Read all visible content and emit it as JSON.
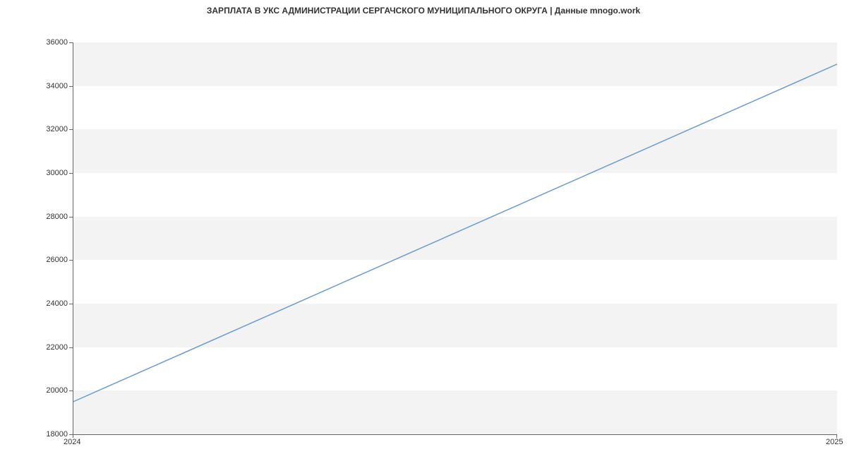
{
  "chart_data": {
    "type": "line",
    "title": "ЗАРПЛАТА В УКС АДМИНИСТРАЦИИ СЕРГАЧСКОГО МУНИЦИПАЛЬНОГО ОКРУГА | Данные mnogo.work",
    "x": [
      2024,
      2025
    ],
    "x_tick_labels": [
      "2024",
      "2025"
    ],
    "y_ticks": [
      18000,
      20000,
      22000,
      24000,
      26000,
      28000,
      30000,
      32000,
      34000,
      36000
    ],
    "series": [
      {
        "name": "salary",
        "values": [
          19500,
          35000
        ],
        "color": "#6b9bd1"
      }
    ],
    "xlabel": "",
    "ylabel": "",
    "ylim": [
      18000,
      36000
    ],
    "xlim": [
      2024,
      2025
    ],
    "grid_bands": true
  }
}
